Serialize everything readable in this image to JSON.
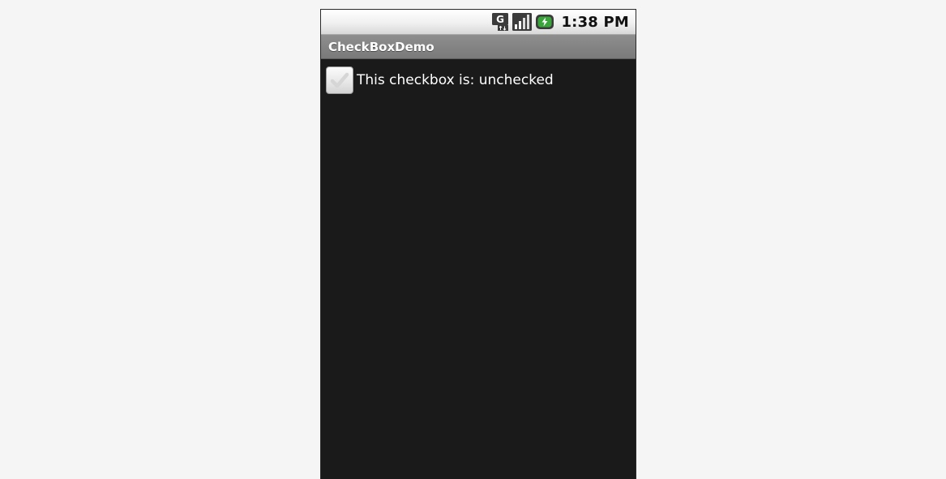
{
  "status_bar": {
    "time": "1:38 PM",
    "icons": [
      "network-type-g-icon",
      "signal-strength-icon",
      "battery-icon"
    ]
  },
  "app": {
    "title": "CheckBoxDemo"
  },
  "checkbox": {
    "label": "This checkbox is: unchecked",
    "checked": false
  },
  "colors": {
    "background": "#f5f5f5",
    "screen": "#1a1a1a",
    "title_bar": "#7f7f7f",
    "text": "#ffffff",
    "battery_green": "#3aa53a"
  }
}
